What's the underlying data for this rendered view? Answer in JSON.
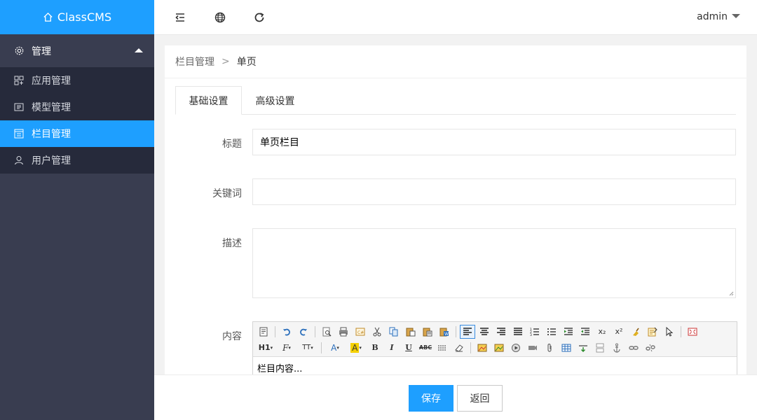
{
  "app": {
    "title": "ClassCMS"
  },
  "sidebar": {
    "group_label": "管理",
    "items": [
      {
        "label": "应用管理",
        "icon": "apps-icon",
        "active": false
      },
      {
        "label": "模型管理",
        "icon": "model-icon",
        "active": false
      },
      {
        "label": "栏目管理",
        "icon": "column-icon",
        "active": true
      },
      {
        "label": "用户管理",
        "icon": "user-icon",
        "active": false
      }
    ]
  },
  "header": {
    "icons": [
      "collapse-menu-icon",
      "globe-icon",
      "refresh-icon"
    ],
    "user": "admin"
  },
  "breadcrumb": {
    "parent": "栏目管理",
    "separator": ">",
    "current": "单页"
  },
  "tabs": [
    {
      "label": "基础设置",
      "active": true
    },
    {
      "label": "高级设置",
      "active": false
    }
  ],
  "form": {
    "title_label": "标题",
    "title_value": "单页栏目",
    "keywords_label": "关键词",
    "keywords_value": "",
    "description_label": "描述",
    "description_value": "",
    "content_label": "内容",
    "content_value": "栏目内容..."
  },
  "editor": {
    "row2_labels": {
      "heading": "H1",
      "font": "F",
      "size": "TT",
      "color": "A",
      "bg": "A",
      "bold": "B",
      "italic": "I",
      "underline": "U",
      "strike": "ABC",
      "sub": "x₂",
      "sup": "x²"
    }
  },
  "actions": {
    "save": "保存",
    "back": "返回"
  },
  "colors": {
    "accent": "#1e9fff",
    "sidebar_bg": "#393d50",
    "subnav_bg": "#262a3b"
  }
}
